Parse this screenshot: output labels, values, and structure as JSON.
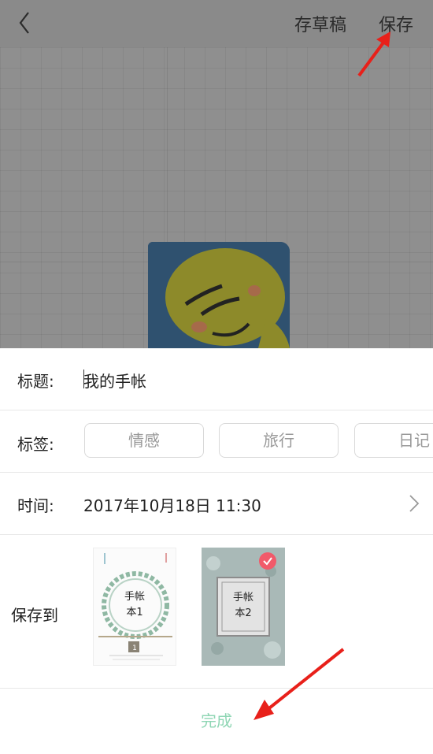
{
  "header": {
    "draft_label": "存草稿",
    "save_label": "保存"
  },
  "form": {
    "title_label": "标题:",
    "title_value": "我的手帐",
    "tags_label": "标签:",
    "tags": [
      "情感",
      "旅行",
      "日记"
    ],
    "time_label": "时间:",
    "time_value": "2017年10月18日 11:30",
    "saveto_label": "保存到",
    "notebooks": [
      {
        "line1": "手帐",
        "line2": "本1",
        "badge": "1",
        "selected": false
      },
      {
        "line1": "手帐",
        "line2": "本2",
        "selected": true
      }
    ],
    "done_label": "完成"
  },
  "colors": {
    "accent_done": "#8fd6b4",
    "check_badge": "#f15a6a",
    "annotation_arrow": "#e8201a"
  }
}
